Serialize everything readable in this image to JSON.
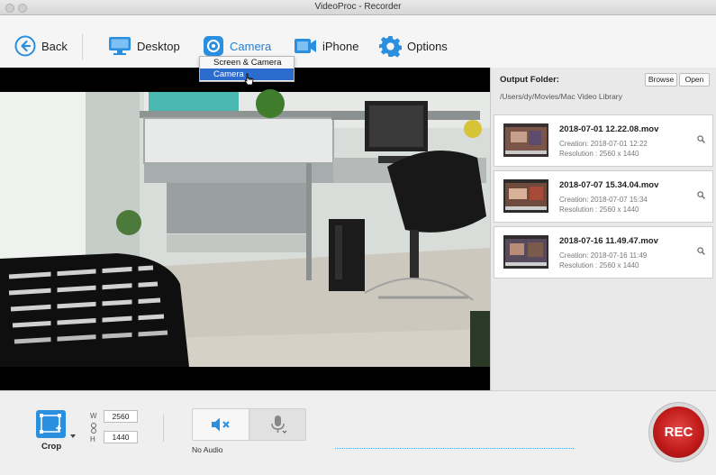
{
  "window": {
    "title": "VideoProc - Recorder"
  },
  "toolbar": {
    "back_label": "Back",
    "desktop_label": "Desktop",
    "camera_label": "Camera",
    "iphone_label": "iPhone",
    "options_label": "Options"
  },
  "camera_menu": {
    "items": [
      {
        "label": "Screen & Camera",
        "selected": false
      },
      {
        "label": "Camera",
        "selected": true
      }
    ]
  },
  "output": {
    "label": "Output Folder:",
    "browse_label": "Browse",
    "open_label": "Open",
    "path": "/Users/dy/Movies/Mac Video Library"
  },
  "recordings": [
    {
      "name": "2018-07-01 12.22.08.mov",
      "creation": "Creation: 2018-07-01 12:22",
      "resolution": "Resolution : 2560 x 1440"
    },
    {
      "name": "2018-07-07 15.34.04.mov",
      "creation": "Creation: 2018-07-07 15:34",
      "resolution": "Resolution : 2560 x 1440"
    },
    {
      "name": "2018-07-16 11.49.47.mov",
      "creation": "Creation: 2018-07-16 11:49",
      "resolution": "Resolution : 2560 x 1440"
    }
  ],
  "crop": {
    "label": "Crop",
    "width_label": "W",
    "height_label": "H",
    "width": "2560",
    "height": "1440"
  },
  "audio": {
    "status": "No Audio"
  },
  "rec_label": "REC",
  "colors": {
    "accent": "#1f7fd8",
    "rec": "#c21b1b",
    "menu_highlight": "#2d6ccf"
  }
}
